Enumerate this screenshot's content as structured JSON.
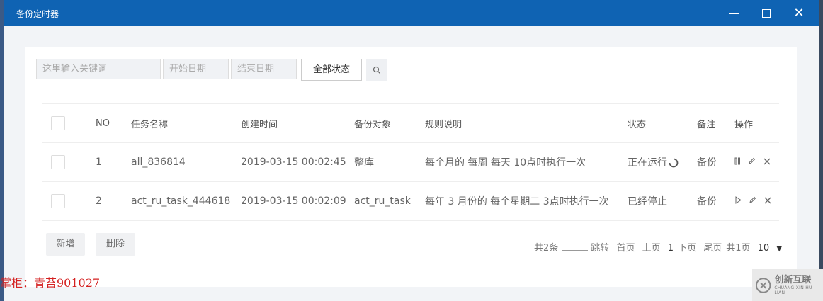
{
  "window": {
    "title": "备份定时器",
    "icons": {
      "minimize": "minimize-icon",
      "maximize": "maximize-icon",
      "close": "close-icon"
    }
  },
  "filters": {
    "keyword_placeholder": "这里输入关键词",
    "start_date_placeholder": "开始日期",
    "end_date_placeholder": "结束日期",
    "status_label": "全部状态",
    "search_icon": "search-icon"
  },
  "table": {
    "headers": {
      "no": "NO",
      "task_name": "任务名称",
      "created": "创建时间",
      "target": "备份对象",
      "rule": "规则说明",
      "status": "状态",
      "note": "备注",
      "actions": "操作"
    },
    "rows": [
      {
        "no": "1",
        "task_name": "all_836814",
        "created": "2019-03-15 00:02:45",
        "target": "整库",
        "rule": "每个月的 每周 每天 10点时执行一次",
        "status": "正在运行",
        "note": "备份",
        "actions": [
          "pause-icon",
          "edit-icon",
          "delete-icon"
        ]
      },
      {
        "no": "2",
        "task_name": "act_ru_task_444618",
        "created": "2019-03-15 00:02:09",
        "target": "act_ru_task",
        "rule": "每年 3 月份的 每个星期二 3点时执行一次",
        "status": "已经停止",
        "note": "备份",
        "actions": [
          "play-icon",
          "edit-icon",
          "delete-icon"
        ]
      }
    ]
  },
  "buttons": {
    "add": "新增",
    "delete": "删除"
  },
  "pager": {
    "total": "共2条",
    "jump": "跳转",
    "first": "首页",
    "prev": "上页",
    "current": "1",
    "next": "下页",
    "last": "尾页",
    "pages": "共1页",
    "page_size": "10"
  },
  "watermark": "掌柜：青苔901027",
  "logo": {
    "cn": "创新互联",
    "en": "CHUANG XIN HU LIAN"
  }
}
